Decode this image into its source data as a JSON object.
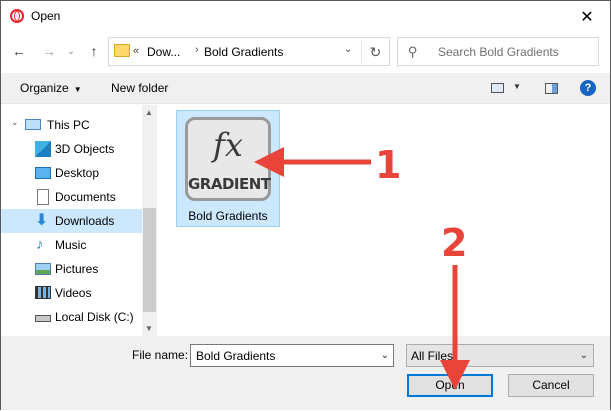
{
  "window": {
    "title": "Open",
    "close_glyph": "✕"
  },
  "nav": {
    "back_glyph": "←",
    "forward_glyph": "→",
    "recent_glyph": "⌄",
    "up_glyph": "↑",
    "breadcrumb_prefix": "«",
    "breadcrumb": [
      "Dow...",
      "Bold Gradients"
    ],
    "separator": "›",
    "refresh_glyph": "↻",
    "search_placeholder": "Search Bold Gradients"
  },
  "toolbar": {
    "organize_label": "Organize",
    "new_folder_label": "New folder",
    "help_glyph": "?"
  },
  "sidebar": {
    "items": [
      {
        "label": "This PC",
        "icon": "pc-icon"
      },
      {
        "label": "3D Objects",
        "icon": "cube-icon"
      },
      {
        "label": "Desktop",
        "icon": "desktop-icon"
      },
      {
        "label": "Documents",
        "icon": "document-icon"
      },
      {
        "label": "Downloads",
        "icon": "download-icon",
        "selected": true
      },
      {
        "label": "Music",
        "icon": "music-icon"
      },
      {
        "label": "Pictures",
        "icon": "pictures-icon"
      },
      {
        "label": "Videos",
        "icon": "video-icon"
      },
      {
        "label": "Local Disk (C:)",
        "icon": "disk-icon"
      }
    ]
  },
  "files": [
    {
      "name": "Bold Gradients",
      "icon_line1": "fx",
      "icon_line2": "GRADIENT",
      "selected": true
    }
  ],
  "footer": {
    "file_name_label": "File name:",
    "file_name_value": "Bold Gradients",
    "file_type_value": "All Files",
    "open_label": "Open",
    "cancel_label": "Cancel"
  },
  "annotations": {
    "step1": "1",
    "step2": "2",
    "color": "#e8443a"
  },
  "colors": {
    "selection": "#cce8ff",
    "accent": "#0078d7"
  }
}
